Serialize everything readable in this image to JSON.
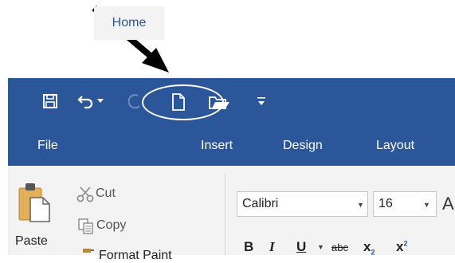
{
  "quick_access": {
    "items": [
      "save-icon",
      "undo-icon",
      "undo-dropdown-icon",
      "redo-icon",
      "new-document-icon",
      "open-folder-icon",
      "customize-qat-icon"
    ],
    "highlight_color": "#ffffff"
  },
  "tabs": [
    {
      "label": "File"
    },
    {
      "label": "Home"
    },
    {
      "label": "Insert"
    },
    {
      "label": "Design"
    },
    {
      "label": "Layout"
    }
  ],
  "clipboard": {
    "paste_label": "Paste",
    "cut_label": "Cut",
    "copy_label": "Copy",
    "format_painter_label": "Format Paint"
  },
  "font": {
    "family": "Calibri",
    "size": "16",
    "grow_label": "A",
    "bold": "B",
    "italic": "I",
    "underline": "U",
    "strikethrough": "abc",
    "subscript": "x",
    "superscript": "x"
  },
  "colors": {
    "accent": "#2b579a",
    "ribbon": "#f3f3f3"
  }
}
